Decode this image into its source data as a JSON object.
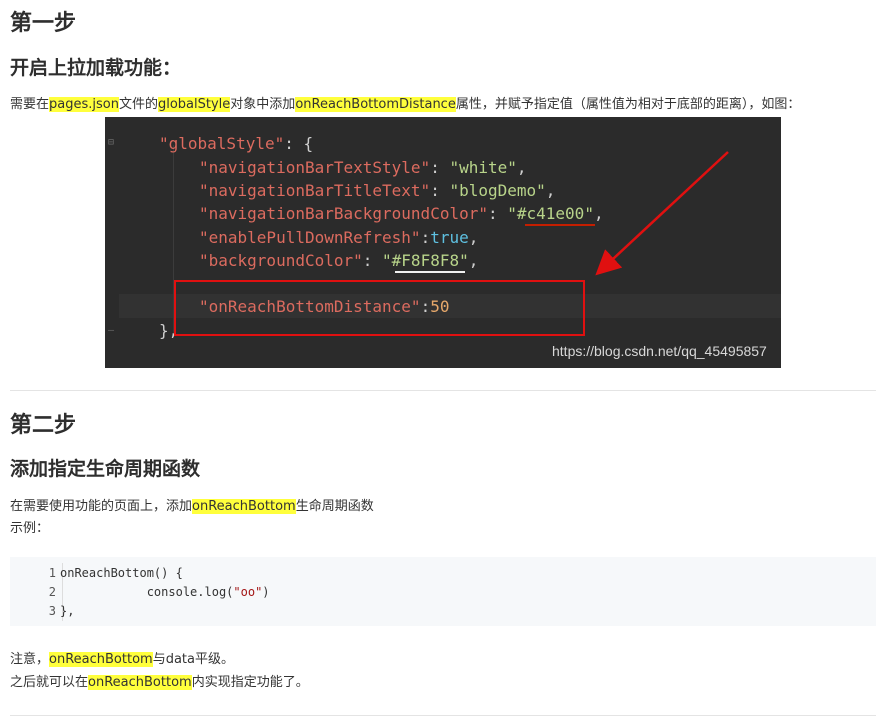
{
  "step1": {
    "title": "第一步",
    "subtitle": "开启上拉加载功能：",
    "desc": {
      "pre": "需要在",
      "m1": "pages.json",
      "t1": "文件的",
      "m2": "globalStyle",
      "t2": "对象中添加",
      "m3": "onReachBottomDistance",
      "t3": "属性，并赋予指定值（属性值为相对于底部的距离），如图："
    },
    "screenshot": {
      "lines": {
        "l1_key": "\"globalStyle\"",
        "l1_rest": ": {",
        "l2_key": "\"navigationBarTextStyle\"",
        "l2_val": "\"white\"",
        "l3_key": "\"navigationBarTitleText\"",
        "l3_val": "\"blogDemo\"",
        "l4_key": "\"navigationBarBackgroundColor\"",
        "l4_val": "\"#c41e00\"",
        "l5_key": "\"enablePullDownRefresh\"",
        "l5_val": "true",
        "l6_key": "\"backgroundColor\"",
        "l6_val": "\"#F8F8F8\"",
        "l7_key": "\"onReachBottomDistance\"",
        "l7_val": "50",
        "l8": "},"
      },
      "watermark": "https://blog.csdn.net/qq_45495857",
      "colors": {
        "annotation_red": "#e01010",
        "underline_1": "#c41e00",
        "underline_2": "#F8F8F8"
      }
    }
  },
  "step2": {
    "title": "第二步",
    "subtitle": "添加指定生命周期函数",
    "desc": {
      "pre": "在需要使用功能的页面上，添加",
      "m1": "onReachBottom",
      "post": "生命周期函数"
    },
    "example_label": "示例：",
    "code": {
      "line_numbers": [
        "1",
        "2",
        "3"
      ],
      "line1": "onReachBottom() {",
      "line2_pre": "            console.log(",
      "line2_str": "\"oo\"",
      "line2_post": ")",
      "line3": "},"
    },
    "note1": {
      "pre": "注意，",
      "m1": "onReachBottom",
      "post": "与data平级。"
    },
    "note2": {
      "pre": "之后就可以在",
      "m1": "onReachBottom",
      "post": "内实现指定功能了。"
    }
  }
}
